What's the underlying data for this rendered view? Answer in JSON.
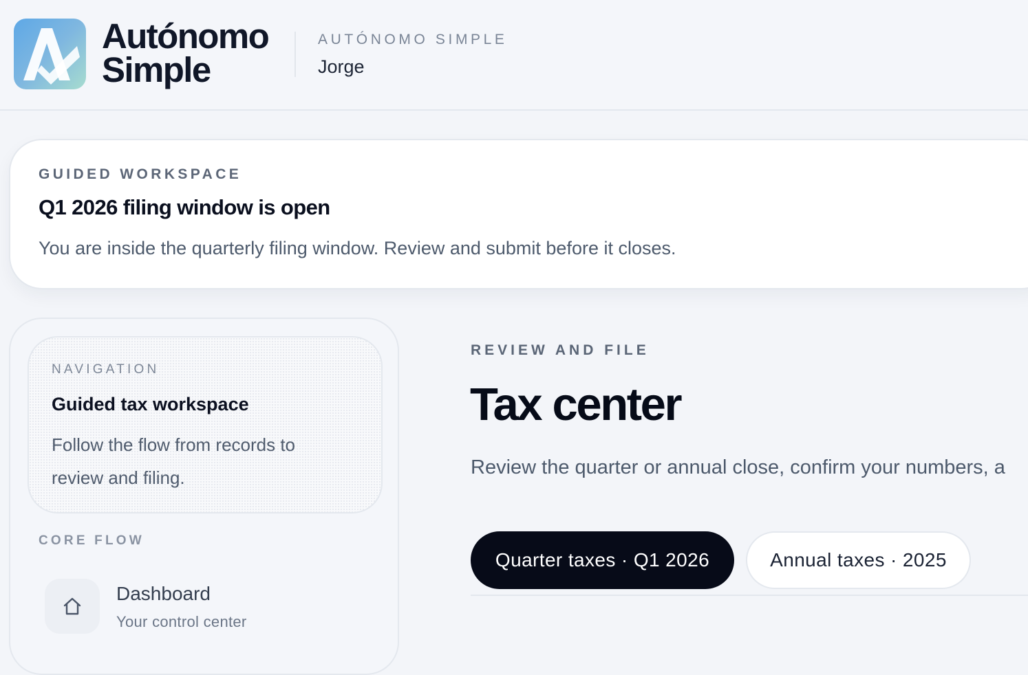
{
  "header": {
    "brand_line1": "Autónomo",
    "brand_line2": "Simple",
    "eyebrow": "AUTÓNOMO SIMPLE",
    "user_name": "Jorge",
    "logo_icon": "autonomo-simple-logo"
  },
  "alert": {
    "eyebrow": "GUIDED WORKSPACE",
    "title": "Q1 2026 filing window is open",
    "body": "You are inside the quarterly filing window. Review and submit before it closes."
  },
  "sidebar": {
    "nav_card": {
      "eyebrow": "NAVIGATION",
      "title": "Guided tax workspace",
      "description": "Follow the flow from records to review and filing."
    },
    "section_label": "CORE FLOW",
    "items": [
      {
        "label": "Dashboard",
        "sub": "Your control center",
        "icon": "home-icon"
      }
    ]
  },
  "main": {
    "eyebrow": "REVIEW AND FILE",
    "title": "Tax center",
    "description": "Review the quarter or annual close, confirm your numbers, a",
    "tabs": [
      {
        "label": "Quarter taxes · Q1 2026",
        "active": true
      },
      {
        "label": "Annual taxes · 2025",
        "active": false
      }
    ]
  },
  "colors": {
    "background": "#f3f5f9",
    "accent_dark": "#070b18",
    "logo_gradient_start": "#5ea8e6",
    "logo_gradient_end": "#a7dccf"
  }
}
